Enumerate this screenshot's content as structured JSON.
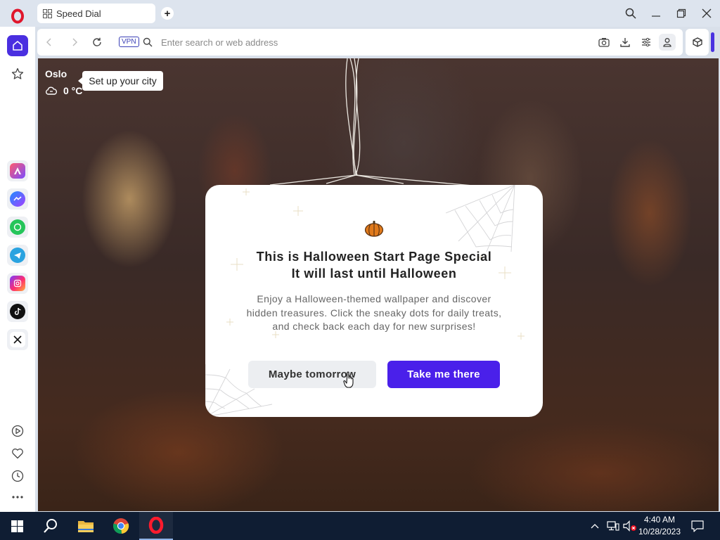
{
  "browser": {
    "tab": {
      "title": "Speed Dial"
    },
    "address_bar": {
      "vpn_label": "VPN",
      "placeholder": "Enter search or web address"
    }
  },
  "sidebar": {
    "items": [
      {
        "name": "home",
        "icon": "home-icon"
      },
      {
        "name": "bookmarks",
        "icon": "star-icon"
      },
      {
        "name": "aria",
        "icon": "aria-icon"
      },
      {
        "name": "messenger",
        "icon": "messenger-icon"
      },
      {
        "name": "whatsapp",
        "icon": "whatsapp-icon"
      },
      {
        "name": "telegram",
        "icon": "telegram-icon"
      },
      {
        "name": "instagram",
        "icon": "instagram-icon"
      },
      {
        "name": "tiktok",
        "icon": "tiktok-icon"
      },
      {
        "name": "x",
        "icon": "x-icon"
      },
      {
        "name": "player",
        "icon": "play-icon"
      },
      {
        "name": "favorites",
        "icon": "heart-icon"
      },
      {
        "name": "history",
        "icon": "clock-icon"
      },
      {
        "name": "more",
        "icon": "more-icon"
      }
    ]
  },
  "weather": {
    "city": "Oslo",
    "setup_tooltip": "Set up your city",
    "temperature": "0 °C",
    "condition_icon": "cloud-icon"
  },
  "dialog": {
    "title_line1": "This is Halloween Start Page Special",
    "title_line2": "It will last until Halloween",
    "description": "Enjoy a Halloween-themed wallpaper and discover hidden treasures. Click the sneaky dots for daily treats, and check back each day for new surprises!",
    "secondary_button": "Maybe tomorrow",
    "primary_button": "Take me there",
    "icon": "pumpkin-icon"
  },
  "taskbar": {
    "time": "4:40 AM",
    "date": "10/28/2023"
  },
  "colors": {
    "accent": "#4a20ea",
    "sidebar_active": "#4a2fe0",
    "opera_red": "#e0162b",
    "taskbar": "#0f1d33"
  }
}
